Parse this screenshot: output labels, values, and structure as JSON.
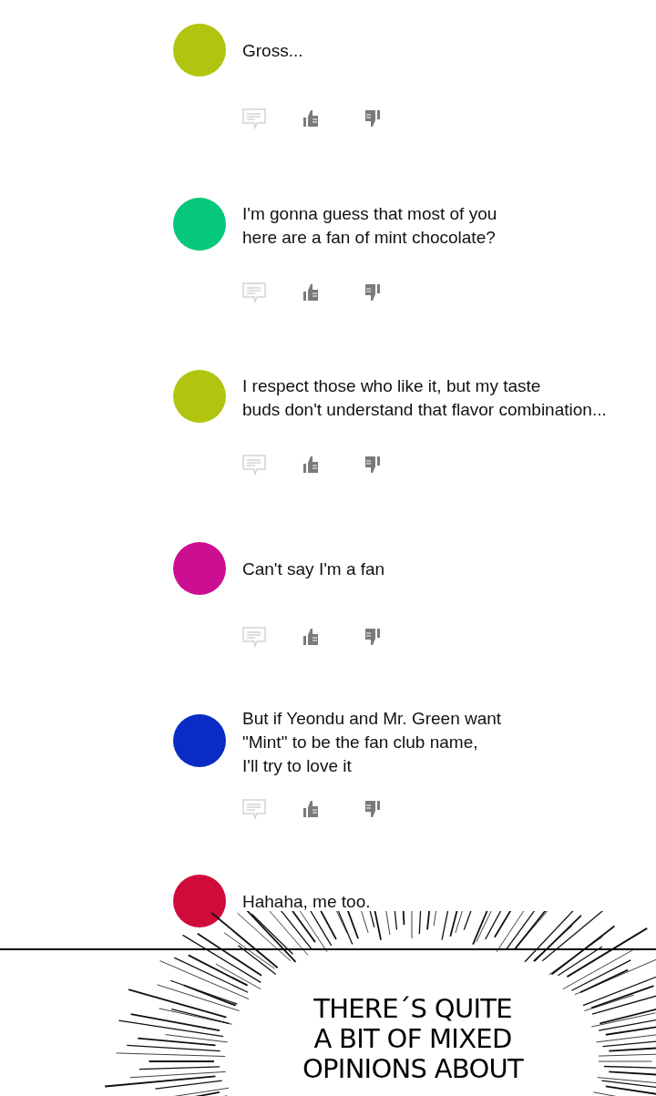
{
  "comments": [
    {
      "color": "#b1c40f",
      "text": "Gross..."
    },
    {
      "color": "#06c87a",
      "text": "I'm gonna guess that most of you\nhere are a fan of mint chocolate?"
    },
    {
      "color": "#b1c40f",
      "text": "I respect those who like it, but my taste\nbuds don't understand that flavor combination..."
    },
    {
      "color": "#cc0e91",
      "text": "Can't say I'm a fan"
    },
    {
      "color": "#0a2cc4",
      "text": "But if Yeondu and Mr. Green want\n\"Mint\" to be the fan club name,\nI'll try to love it"
    }
  ],
  "cut_off_comment": {
    "color": "#d10a3c",
    "text": "Hahaha, me too."
  },
  "caption": [
    "THERE´S QUITE",
    "A BIT OF MIXED",
    "OPINIONS ABOUT"
  ]
}
